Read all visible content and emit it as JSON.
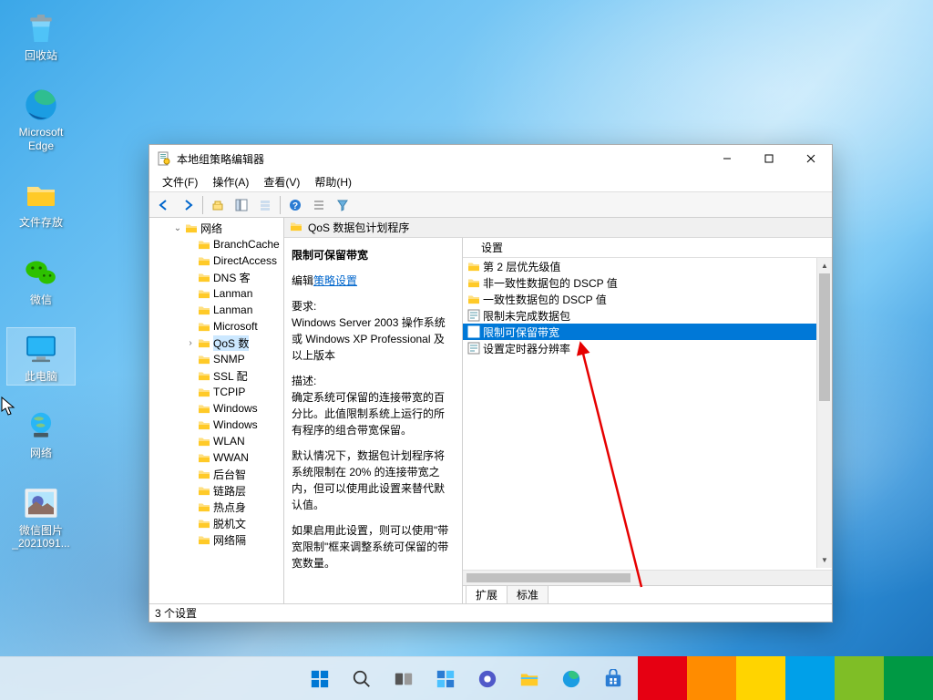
{
  "desktop": {
    "recycle": "回收站",
    "edge": "Microsoft\nEdge",
    "folder": "文件存放",
    "wechat": "微信",
    "thispc": "此电脑",
    "network": "网络",
    "photo": "微信图片\n_2021091..."
  },
  "window": {
    "title": "本地组策略编辑器",
    "menu": {
      "file": "文件(F)",
      "action": "操作(A)",
      "view": "查看(V)",
      "help": "帮助(H)"
    }
  },
  "tree": {
    "root": "网络",
    "items": [
      "BranchCache",
      "DirectAccess",
      "DNS 客",
      "Lanman",
      "Lanman",
      "Microsoft",
      "QoS 数",
      "SNMP",
      "SSL 配",
      "TCPIP",
      "Windows",
      "Windows",
      "WLAN",
      "WWAN",
      "后台智",
      "链路层",
      "热点身",
      "脱机文",
      "网络隔"
    ]
  },
  "addressbar": "QoS 数据包计划程序",
  "desc": {
    "title": "限制可保留带宽",
    "edit_label": "编辑",
    "edit_link": "策略设置",
    "req_label": "要求:",
    "req_body": "Windows Server 2003 操作系统或 Windows XP Professional 及以上版本",
    "desc_label": "描述:",
    "desc_body1": "确定系统可保留的连接带宽的百分比。此值限制系统上运行的所有程序的组合带宽保留。",
    "desc_body2": "默认情况下，数据包计划程序将系统限制在 20% 的连接带宽之内，但可以使用此设置来替代默认值。",
    "desc_body3": "如果启用此设置，则可以使用\"带宽限制\"框来调整系统可保留的带宽数量。"
  },
  "list": {
    "header": "设置",
    "items": [
      {
        "kind": "folder",
        "label": "第 2 层优先级值"
      },
      {
        "kind": "folder",
        "label": "非一致性数据包的 DSCP 值"
      },
      {
        "kind": "folder",
        "label": "一致性数据包的 DSCP 值"
      },
      {
        "kind": "setting",
        "label": "限制未完成数据包"
      },
      {
        "kind": "setting",
        "label": "限制可保留带宽",
        "selected": true
      },
      {
        "kind": "setting",
        "label": "设置定时器分辨率"
      }
    ]
  },
  "tabs": {
    "extended": "扩展",
    "standard": "标准"
  },
  "status": "3 个设置",
  "taskbar_colors": [
    "#e60012",
    "#ff8c00",
    "#ffd400",
    "#00a0e9",
    "#7fbe26",
    "#009944"
  ],
  "taskbar_widths": [
    54,
    54,
    54,
    54,
    54,
    54
  ]
}
